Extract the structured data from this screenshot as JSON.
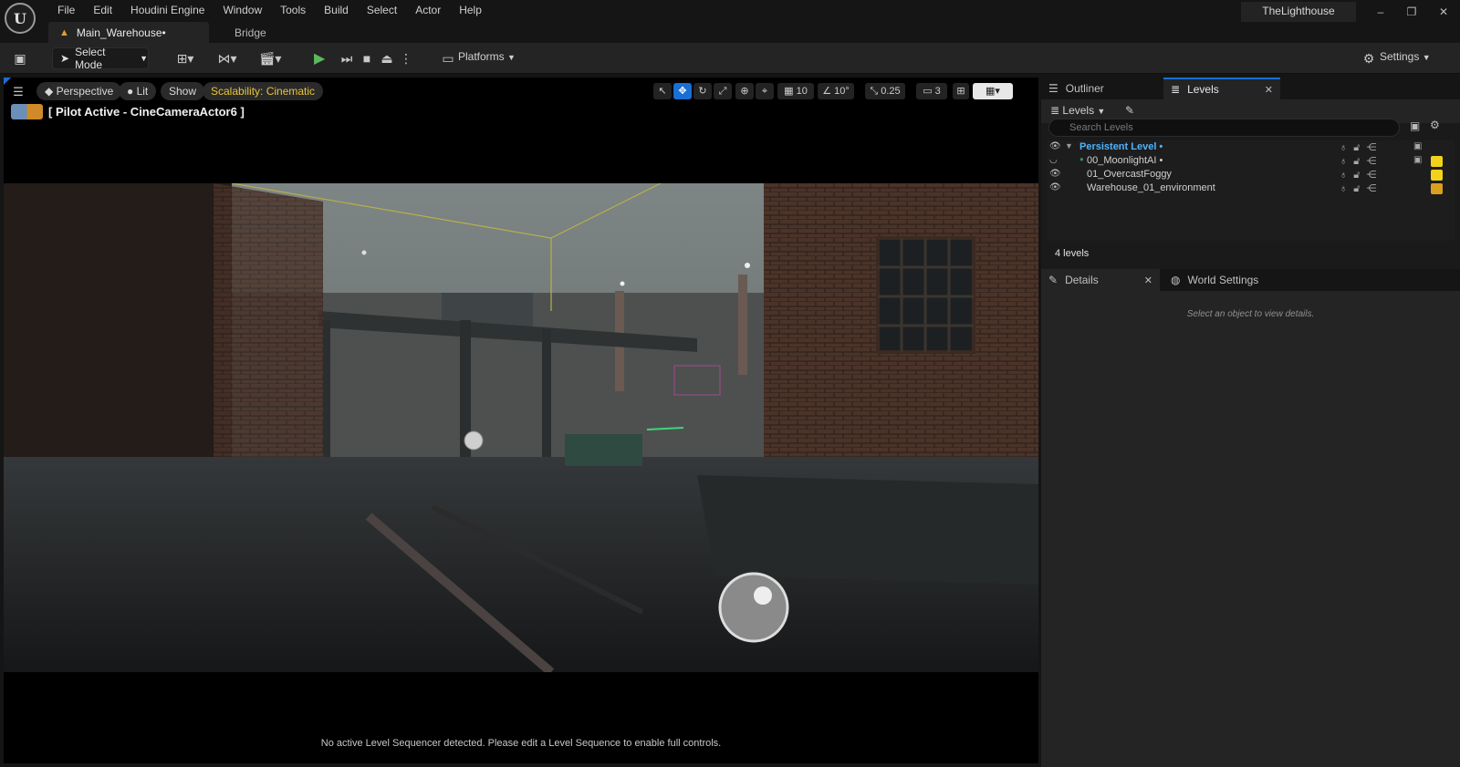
{
  "app": {
    "logo": "U",
    "menu": [
      "File",
      "Edit",
      "Houdini Engine",
      "Window",
      "Tools",
      "Build",
      "Select",
      "Actor",
      "Help"
    ],
    "project_name": "TheLighthouse",
    "window_buttons": {
      "minimize": "–",
      "restore": "❐",
      "close": "✕"
    }
  },
  "tabs": {
    "main": "Main_Warehouse•",
    "bridge": "Bridge"
  },
  "toolbar": {
    "select_mode": "Select Mode",
    "platforms": "Platforms",
    "settings": "Settings"
  },
  "viewport": {
    "perspective": "Perspective",
    "lit": "Lit",
    "show": "Show",
    "scalability": "Scalability: Cinematic",
    "grid_snap": "10",
    "rotation_snap": "10°",
    "scale_snap": "0.25",
    "camera_speed": "3",
    "pilot": "[ Pilot Active - CineCameraActor6 ]",
    "sequencer_message": "No active Level Sequencer detected. Please edit a Level Sequence to enable full controls."
  },
  "panels": {
    "outliner_tab": "Outliner",
    "levels_tab": "Levels",
    "levels_dropdown": "Levels",
    "search_placeholder": "Search Levels",
    "levels": [
      {
        "name": "Persistent Level •",
        "color": "#4fb3ff"
      },
      {
        "name": "00_MoonlightAI •",
        "color": "#f2d21b"
      },
      {
        "name": "01_OvercastFoggy",
        "color": "#f2d21b"
      },
      {
        "name": "Warehouse_01_environment",
        "color": "#d9a020"
      }
    ],
    "levels_count": "4 levels",
    "details_tab": "Details",
    "world_settings_tab": "World Settings",
    "details_hint": "Select an object to view details."
  },
  "colors": {
    "accent": "#1a6fd4",
    "scalability": "#e8c33a",
    "play": "#5cb85c",
    "persistent_level": "#4fb3ff"
  }
}
